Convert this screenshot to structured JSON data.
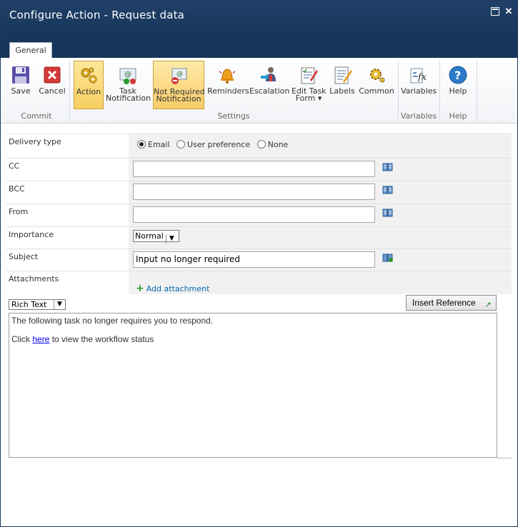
{
  "window": {
    "title": "Configure Action - Request data"
  },
  "tabs": [
    {
      "label": "General"
    }
  ],
  "ribbon": {
    "buttons": [
      {
        "label": "Save"
      },
      {
        "label": "Cancel"
      },
      {
        "label": "Action"
      },
      {
        "label": "Task",
        "label2": "Notification"
      },
      {
        "label": "Not Required",
        "label2": "Notification"
      },
      {
        "label": "Reminders"
      },
      {
        "label": "Escalation"
      },
      {
        "label": "Edit Task",
        "label2": "Form"
      },
      {
        "label": "Labels"
      },
      {
        "label": "Common"
      },
      {
        "label": "Variables"
      },
      {
        "label": "Help"
      }
    ],
    "groups": [
      {
        "label": "Commit"
      },
      {
        "label": "Settings"
      },
      {
        "label": "Variables"
      },
      {
        "label": "Help"
      }
    ]
  },
  "form": {
    "delivery_type": {
      "label": "Delivery type",
      "options": [
        "Email",
        "User preference",
        "None"
      ],
      "selected": "Email"
    },
    "cc": {
      "label": "CC",
      "value": ""
    },
    "bcc": {
      "label": "BCC",
      "value": ""
    },
    "from": {
      "label": "From",
      "value": ""
    },
    "importance": {
      "label": "Importance",
      "value": "Normal"
    },
    "subject": {
      "label": "Subject",
      "value": "Input no longer required"
    },
    "attachments": {
      "label": "Attachments",
      "add_label": "Add attachment"
    }
  },
  "editor": {
    "format": "Rich Text",
    "insert_reference": "Insert Reference",
    "line1": "The following task no longer requires you to respond.",
    "line2_pre": "Click ",
    "line2_link": "here",
    "line2_post": " to view the workflow status"
  }
}
